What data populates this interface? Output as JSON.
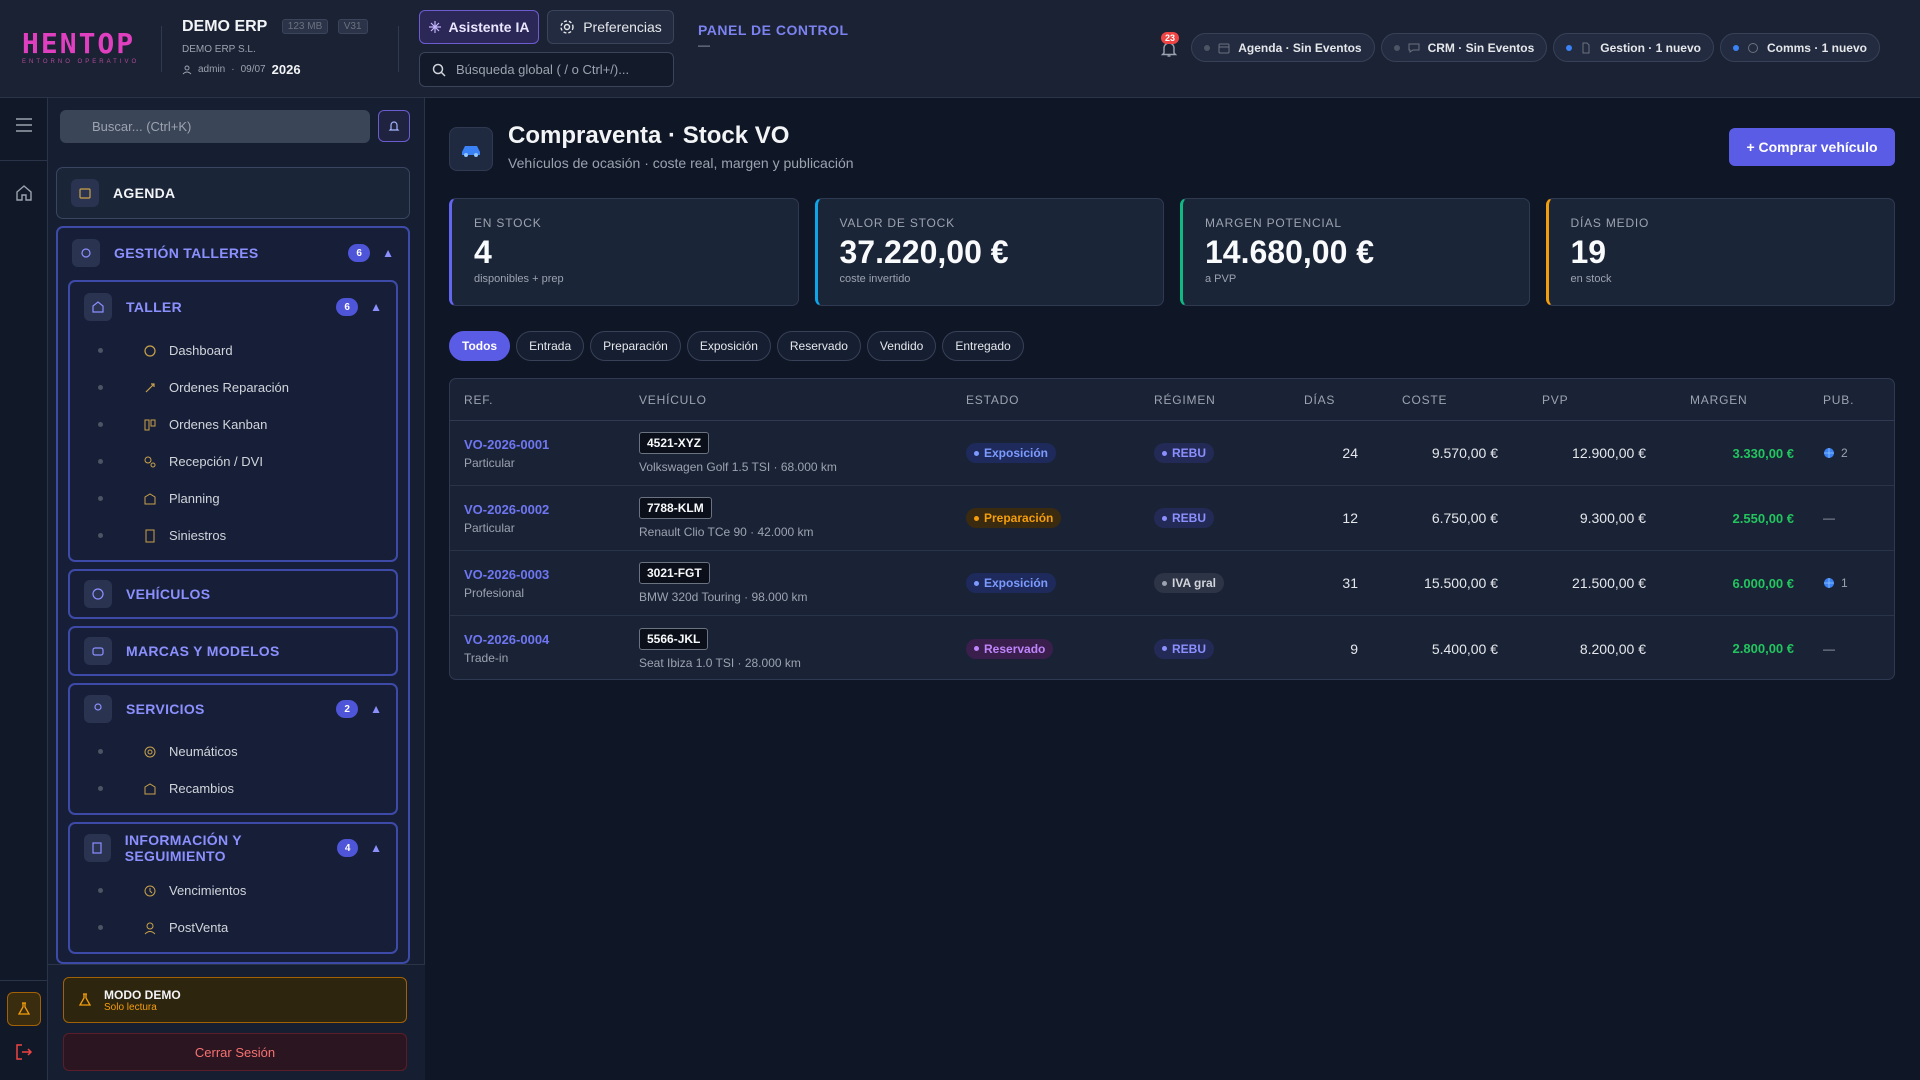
{
  "header": {
    "logo_text": "HENTOP",
    "logo_tagline": "ENTORNO OPERATIVO",
    "brand_name": "DEMO ERP",
    "mem_chip": "123 MB",
    "version_chip": "V31",
    "company": "DEMO ERP S.L.",
    "user": "admin",
    "date": "09/07",
    "year": "2026",
    "ai_button": "Asistente IA",
    "prefs_button": "Preferencias",
    "search_placeholder": "Búsqueda global ( / o Ctrl+/)...",
    "panel_title": "PANEL DE CONTROL",
    "panel_sub": "—",
    "notif_count": "23",
    "pills": [
      {
        "label": "Agenda · Sin Eventos",
        "icon": "calendar-icon",
        "active": false
      },
      {
        "label": "CRM · Sin Eventos",
        "icon": "chat-icon",
        "active": false
      },
      {
        "label": "Gestion · 1 nuevo",
        "icon": "document-icon",
        "active": true
      },
      {
        "label": "Comms · 1 nuevo",
        "icon": "message-icon",
        "active": true
      }
    ]
  },
  "sidebar": {
    "search_placeholder": "Buscar... (Ctrl+K)",
    "agenda": "AGENDA",
    "gestion": {
      "label": "GESTIÓN TALLERES",
      "count": "6"
    },
    "taller": {
      "label": "TALLER",
      "count": "6",
      "items": [
        "Dashboard",
        "Ordenes Reparación",
        "Ordenes Kanban",
        "Recepción / DVI",
        "Planning",
        "Siniestros"
      ]
    },
    "vehiculos": "VEHÍCULOS",
    "marcas": "MARCAS Y MODELOS",
    "servicios": {
      "label": "SERVICIOS",
      "count": "2",
      "items": [
        "Neumáticos",
        "Recambios"
      ]
    },
    "info": {
      "label": "INFORMACIÓN Y SEGUIMIENTO",
      "count": "4",
      "items": [
        "Vencimientos",
        "PostVenta"
      ]
    },
    "demo_title": "MODO DEMO",
    "demo_sub": "Solo lectura",
    "logout": "Cerrar Sesión"
  },
  "page": {
    "title": "Compraventa · Stock VO",
    "subtitle": "Vehículos de ocasión · coste real, margen y publicación",
    "buy_button": "+ Comprar vehículo",
    "kpis": [
      {
        "label": "EN STOCK",
        "value": "4",
        "hint": "disponibles + prep",
        "color": "#6366f1"
      },
      {
        "label": "VALOR DE STOCK",
        "value": "37.220,00 €",
        "hint": "coste invertido",
        "color": "#0ea5e9"
      },
      {
        "label": "MARGEN POTENCIAL",
        "value": "14.680,00 €",
        "hint": "a PVP",
        "color": "#10b981"
      },
      {
        "label": "DÍAS MEDIO",
        "value": "19",
        "hint": "en stock",
        "color": "#f59e0b"
      }
    ],
    "tabs": [
      "Todos",
      "Entrada",
      "Preparación",
      "Exposición",
      "Reservado",
      "Vendido",
      "Entregado"
    ],
    "active_tab": "Todos",
    "columns": [
      "REF.",
      "VEHÍCULO",
      "ESTADO",
      "RÉGIMEN",
      "DÍAS",
      "COSTE",
      "PVP",
      "MARGEN",
      "PUB."
    ],
    "rows": [
      {
        "ref": "VO-2026-0001",
        "type": "Particular",
        "plate": "4521-XYZ",
        "desc": "Volkswagen Golf 1.5 TSI · 68.000 km",
        "estado": "Exposición",
        "regimen": "REBU",
        "dias": "24",
        "coste": "9.570,00 €",
        "pvp": "12.900,00 €",
        "margen": "3.330,00 €",
        "pub": "2"
      },
      {
        "ref": "VO-2026-0002",
        "type": "Particular",
        "plate": "7788-KLM",
        "desc": "Renault Clio TCe 90 · 42.000 km",
        "estado": "Preparación",
        "regimen": "REBU",
        "dias": "12",
        "coste": "6.750,00 €",
        "pvp": "9.300,00 €",
        "margen": "2.550,00 €",
        "pub": "—"
      },
      {
        "ref": "VO-2026-0003",
        "type": "Profesional",
        "plate": "3021-FGT",
        "desc": "BMW 320d Touring · 98.000 km",
        "estado": "Exposición",
        "regimen": "IVA gral",
        "dias": "31",
        "coste": "15.500,00 €",
        "pvp": "21.500,00 €",
        "margen": "6.000,00 €",
        "pub": "1"
      },
      {
        "ref": "VO-2026-0004",
        "type": "Trade-in",
        "plate": "5566-JKL",
        "desc": "Seat Ibiza 1.0 TSI · 28.000 km",
        "estado": "Reservado",
        "regimen": "REBU",
        "dias": "9",
        "coste": "5.400,00 €",
        "pvp": "8.200,00 €",
        "margen": "2.800,00 €",
        "pub": "—"
      }
    ]
  }
}
